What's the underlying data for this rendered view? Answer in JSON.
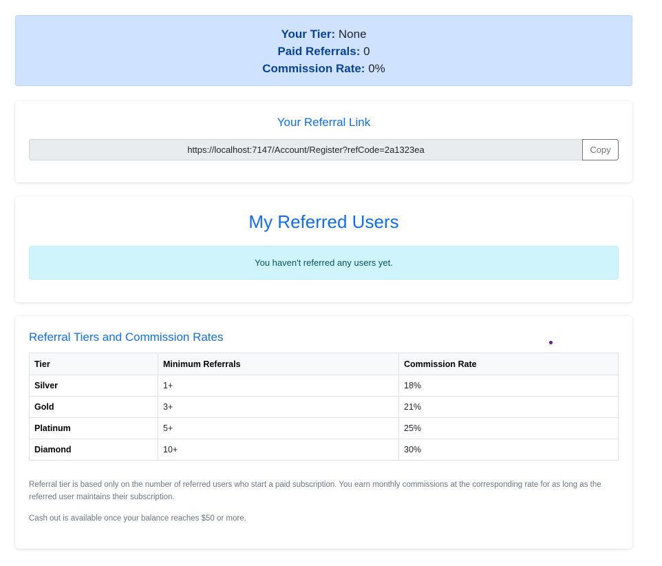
{
  "summary": {
    "tier_label": "Your Tier:",
    "tier_value": "None",
    "paid_label": "Paid Referrals:",
    "paid_value": "0",
    "rate_label": "Commission Rate:",
    "rate_value": "0%"
  },
  "referral_link": {
    "title": "Your Referral Link",
    "url": "https://localhost:7147/Account/Register?refCode=2a1323ea",
    "copy_label": "Copy"
  },
  "referred_users": {
    "title": "My Referred Users",
    "empty_message": "You haven't referred any users yet."
  },
  "tiers": {
    "title": "Referral Tiers and Commission Rates",
    "headers": [
      "Tier",
      "Minimum Referrals",
      "Commission Rate"
    ],
    "rows": [
      [
        "Silver",
        "1+",
        "18%"
      ],
      [
        "Gold",
        "3+",
        "21%"
      ],
      [
        "Platinum",
        "5+",
        "25%"
      ],
      [
        "Diamond",
        "10+",
        "30%"
      ]
    ],
    "note_1": "Referral tier is based only on the number of referred users who start a paid subscription. You earn monthly commissions at the corresponding rate for as long as the referred user maintains their subscription.",
    "note_2": "Cash out is available once your balance reaches $50 or more."
  },
  "colors": {
    "primary": "#0d6efd",
    "summary_bg": "#cfe2ff",
    "info_bg": "#cff4fc",
    "cursor_dot": "#6a0dad"
  }
}
